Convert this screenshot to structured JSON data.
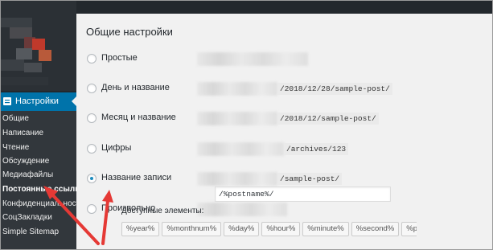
{
  "sidebar": {
    "active_menu": "Настройки",
    "submenu": [
      {
        "label": "Общие",
        "current": false
      },
      {
        "label": "Написание",
        "current": false
      },
      {
        "label": "Чтение",
        "current": false
      },
      {
        "label": "Обсуждение",
        "current": false
      },
      {
        "label": "Медиафайлы",
        "current": false
      },
      {
        "label": "Постоянные ссылки",
        "current": true
      },
      {
        "label": "Конфиденциальность",
        "current": false
      },
      {
        "label": "СоцЗакладки",
        "current": false
      },
      {
        "label": "Simple Sitemap",
        "current": false
      }
    ]
  },
  "main": {
    "heading": "Общие настройки",
    "options": [
      {
        "label": "Простые",
        "selected": false,
        "example": ""
      },
      {
        "label": "День и название",
        "selected": false,
        "example": "/2018/12/28/sample-post/"
      },
      {
        "label": "Месяц и название",
        "selected": false,
        "example": "/2018/12/sample-post/"
      },
      {
        "label": "Цифры",
        "selected": false,
        "example": "/archives/123"
      },
      {
        "label": "Название записи",
        "selected": true,
        "example": "/sample-post/"
      },
      {
        "label": "Произвольно",
        "selected": false,
        "example": ""
      }
    ],
    "custom_structure_value": "/%postname%/",
    "available_tags_label": "Доступные элементы:",
    "tags": [
      "%year%",
      "%monthnum%",
      "%day%",
      "%hour%",
      "%minute%",
      "%second%",
      "%post_id%"
    ]
  },
  "colors": {
    "admin_bar": "#23282d",
    "active_menu": "#0073aa",
    "annotation_arrow": "#e53935",
    "radio_selected": "#1e8cbe"
  }
}
